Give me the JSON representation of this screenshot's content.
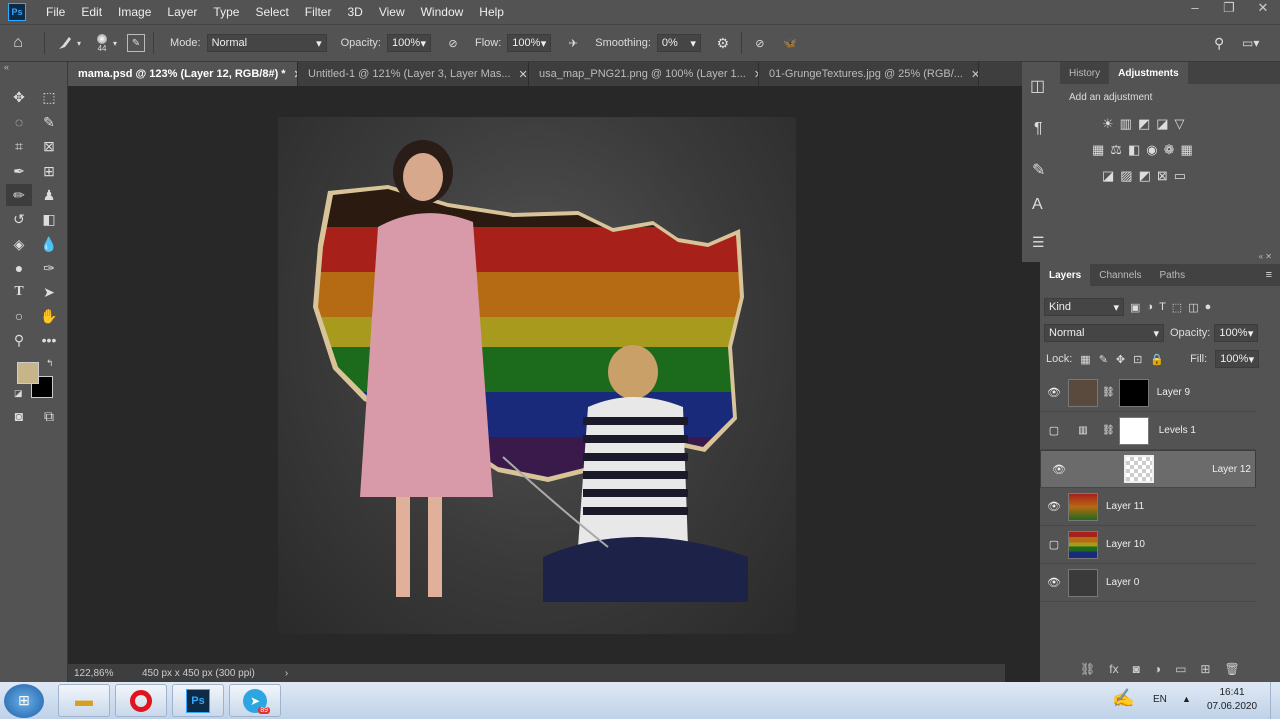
{
  "app": {
    "logo": "Ps"
  },
  "menu": [
    "File",
    "Edit",
    "Image",
    "Layer",
    "Type",
    "Select",
    "Filter",
    "3D",
    "View",
    "Window",
    "Help"
  ],
  "window_controls": [
    "–",
    "❐",
    "✕"
  ],
  "options": {
    "brush_size": "44",
    "mode_label": "Mode:",
    "mode_value": "Normal",
    "opacity_label": "Opacity:",
    "opacity_value": "100%",
    "flow_label": "Flow:",
    "flow_value": "100%",
    "smoothing_label": "Smoothing:",
    "smoothing_value": "0%"
  },
  "tabs": [
    {
      "label": "mama.psd @ 123% (Layer 12, RGB/8#) *"
    },
    {
      "label": "Untitled-1 @ 121% (Layer 3, Layer Mas..."
    },
    {
      "label": "usa_map_PNG21.png @ 100% (Layer 1..."
    },
    {
      "label": "01-GrungeTextures.jpg @ 25% (RGB/..."
    }
  ],
  "status": {
    "zoom": "122,86%",
    "doc_size": "450 px x 450 px (300 ppi)"
  },
  "right_panel": {
    "tab_history": "History",
    "tab_adjustments": "Adjustments",
    "add_adjustment": "Add an adjustment"
  },
  "layers_panel": {
    "tab_layers": "Layers",
    "tab_channels": "Channels",
    "tab_paths": "Paths",
    "kind": "Kind",
    "blend_mode": "Normal",
    "opacity_label": "Opacity:",
    "opacity_value": "100%",
    "lock_label": "Lock:",
    "fill_label": "Fill:",
    "fill_value": "100%",
    "layers": [
      {
        "name": "Layer 9",
        "visible": true
      },
      {
        "name": "Levels 1",
        "visible": false
      },
      {
        "name": "Layer 12",
        "visible": true,
        "selected": true
      },
      {
        "name": "Layer 11",
        "visible": true
      },
      {
        "name": "Layer 10",
        "visible": false
      },
      {
        "name": "Layer 0",
        "visible": true
      }
    ]
  },
  "taskbar": {
    "lang": "EN",
    "time": "16:41",
    "date": "07.06.2020",
    "telegram_badge": "89"
  },
  "colors": {
    "foreground": "#c7b488",
    "background": "#000000",
    "accent": "#31a8ff"
  }
}
